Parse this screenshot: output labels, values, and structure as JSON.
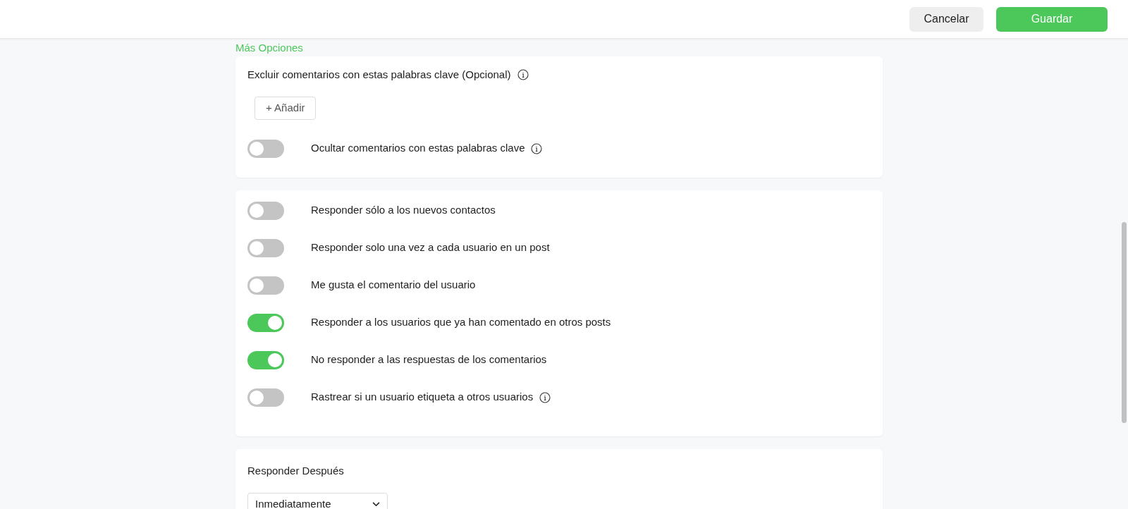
{
  "header": {
    "buttons": [
      {
        "label": "Cancelar",
        "kind": "secondary"
      },
      {
        "label": "Guardar",
        "kind": "primary"
      }
    ]
  },
  "section_title": "Más Opciones",
  "exclude_card": {
    "label": "Excluir comentarios con estas palabras clave (Opcional)",
    "add_button": "+ Añadir",
    "toggles": [
      {
        "label": "Ocultar comentarios con estas palabras clave",
        "on": false,
        "info": true
      }
    ]
  },
  "options_card": {
    "toggles": [
      {
        "label": "Responder sólo a los nuevos contactos",
        "on": false,
        "info": false
      },
      {
        "label": "Responder solo una vez a cada usuario en un post",
        "on": false,
        "info": false
      },
      {
        "label": "Me gusta el comentario del usuario",
        "on": false,
        "info": false
      },
      {
        "label": "Responder a los usuarios que ya han comentado en otros posts",
        "on": true,
        "info": false
      },
      {
        "label": "No responder a las respuestas de los comentarios",
        "on": true,
        "info": false
      },
      {
        "label": "Rastrear si un usuario etiqueta a otros usuarios",
        "on": false,
        "info": true
      }
    ]
  },
  "reply_after_card": {
    "label": "Responder Después",
    "select": {
      "value": "Inmediatamente"
    }
  }
}
